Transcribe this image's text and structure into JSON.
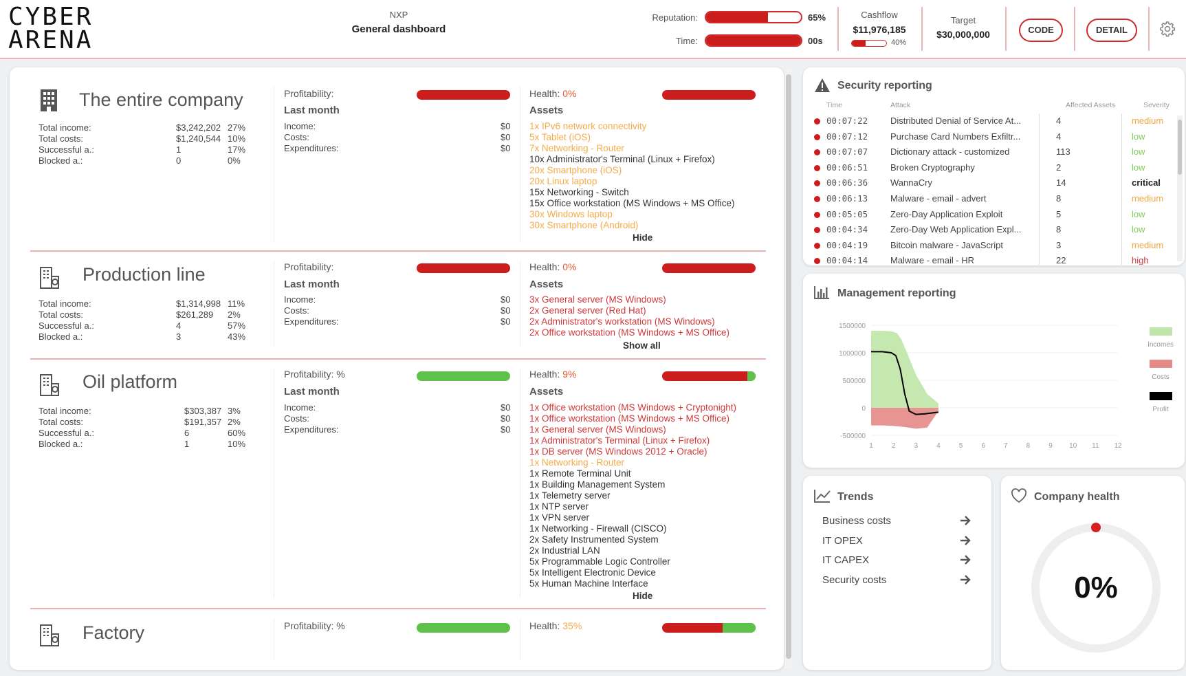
{
  "header": {
    "logo_line1": "CYBER",
    "logo_line2": "ARENA",
    "org": "NXP",
    "title": "General dashboard",
    "reputation_label": "Reputation:",
    "reputation_value": "65%",
    "reputation_level": 0.65,
    "time_label": "Time:",
    "time_value": "00s",
    "time_level": 1.0,
    "cashflow_label": "Cashflow",
    "cashflow_value": "$11,976,185",
    "cashflow_percent": "40%",
    "cashflow_level": 0.4,
    "target_label": "Target",
    "target_value": "$30,000,000",
    "code_button": "CODE",
    "detail_button": "DETAIL"
  },
  "sections": [
    {
      "title": "The entire company",
      "stats": [
        {
          "label": "Total income:",
          "value": "$3,242,202",
          "pct": "27%"
        },
        {
          "label": "Total costs:",
          "value": "$1,240,544",
          "pct": "10%"
        },
        {
          "label": "Successful a.:",
          "value": "1",
          "pct": "17%"
        },
        {
          "label": "Blocked a.:",
          "value": "0",
          "pct": "0%"
        }
      ],
      "profitability_label": "Profitability:",
      "last_month": "Last month",
      "lm": [
        {
          "label": "Income:",
          "value": "$0"
        },
        {
          "label": "Costs:",
          "value": "$0"
        },
        {
          "label": "Expenditures:",
          "value": "$0"
        }
      ],
      "health_label": "Health:",
      "health_value": "0%",
      "assets_label": "Assets",
      "assets": [
        {
          "text": "1x IPv6 network connectivity",
          "color": "orange"
        },
        {
          "text": "5x Tablet (iOS)",
          "color": "orange"
        },
        {
          "text": "7x Networking - Router",
          "color": "orange"
        },
        {
          "text": "10x Administrator's Terminal (Linux + Firefox)",
          "color": "dark"
        },
        {
          "text": "20x Smartphone (iOS)",
          "color": "orange"
        },
        {
          "text": "20x Linux laptop",
          "color": "orange"
        },
        {
          "text": "15x Networking - Switch",
          "color": "dark"
        },
        {
          "text": "15x Office workstation (MS Windows + MS Office)",
          "color": "dark"
        },
        {
          "text": "30x Windows laptop",
          "color": "orange"
        },
        {
          "text": "30x Smartphone (Android)",
          "color": "orange"
        }
      ],
      "toggle": "Hide"
    },
    {
      "title": "Production line",
      "stats": [
        {
          "label": "Total income:",
          "value": "$1,314,998",
          "pct": "11%"
        },
        {
          "label": "Total costs:",
          "value": "$261,289",
          "pct": "2%"
        },
        {
          "label": "Successful a.:",
          "value": "4",
          "pct": "57%"
        },
        {
          "label": "Blocked a.:",
          "value": "3",
          "pct": "43%"
        }
      ],
      "profitability_label": "Profitability:",
      "last_month": "Last month",
      "lm": [
        {
          "label": "Income:",
          "value": "$0"
        },
        {
          "label": "Costs:",
          "value": "$0"
        },
        {
          "label": "Expenditures:",
          "value": "$0"
        }
      ],
      "health_label": "Health:",
      "health_value": "0%",
      "assets_label": "Assets",
      "assets": [
        {
          "text": "3x General server (MS Windows)",
          "color": "red"
        },
        {
          "text": "2x General server (Red Hat)",
          "color": "red"
        },
        {
          "text": "2x Administrator's workstation (MS Windows)",
          "color": "red"
        },
        {
          "text": "2x Office workstation (MS Windows + MS Office)",
          "color": "red"
        }
      ],
      "toggle": "Show all"
    },
    {
      "title": "Oil platform",
      "stats": [
        {
          "label": "Total income:",
          "value": "$303,387",
          "pct": "3%"
        },
        {
          "label": "Total costs:",
          "value": "$191,357",
          "pct": "2%"
        },
        {
          "label": "Successful a.:",
          "value": "6",
          "pct": "60%"
        },
        {
          "label": "Blocked a.:",
          "value": "1",
          "pct": "10%"
        }
      ],
      "profitability_label": "Profitability: %",
      "last_month": "Last month",
      "lm": [
        {
          "label": "Income:",
          "value": "$0"
        },
        {
          "label": "Costs:",
          "value": "$0"
        },
        {
          "label": "Expenditures:",
          "value": "$0"
        }
      ],
      "health_label": "Health:",
      "health_value": "9%",
      "assets_label": "Assets",
      "assets": [
        {
          "text": "1x Office workstation (MS Windows + Cryptonight)",
          "color": "red"
        },
        {
          "text": "1x Office workstation (MS Windows + MS Office)",
          "color": "red"
        },
        {
          "text": "1x General server (MS Windows)",
          "color": "red"
        },
        {
          "text": "1x Administrator's Terminal (Linux + Firefox)",
          "color": "red"
        },
        {
          "text": "1x DB server (MS Windows 2012 + Oracle)",
          "color": "red"
        },
        {
          "text": "1x Networking - Router",
          "color": "orange"
        },
        {
          "text": "1x Remote Terminal Unit",
          "color": "dark"
        },
        {
          "text": "1x Building Management System",
          "color": "dark"
        },
        {
          "text": "1x Telemetry server",
          "color": "dark"
        },
        {
          "text": "1x NTP server",
          "color": "dark"
        },
        {
          "text": "1x VPN server",
          "color": "dark"
        },
        {
          "text": "1x Networking - Firewall (CISCO)",
          "color": "dark"
        },
        {
          "text": "2x Safety Instrumented System",
          "color": "dark"
        },
        {
          "text": "2x Industrial LAN",
          "color": "dark"
        },
        {
          "text": "5x Programmable Logic Controller",
          "color": "dark"
        },
        {
          "text": "5x Intelligent Electronic Device",
          "color": "dark"
        },
        {
          "text": "5x Human Machine Interface",
          "color": "dark"
        }
      ],
      "toggle": "Hide"
    },
    {
      "title": "Factory",
      "profitability_label": "Profitability: %",
      "health_label": "Health:",
      "health_value": "35%"
    }
  ],
  "security": {
    "title": "Security reporting",
    "columns": [
      "Time",
      "Attack",
      "Affected Assets",
      "Severity"
    ],
    "rows": [
      {
        "time": "00:07:22",
        "attack": "Distributed Denial of Service At...",
        "assets": "4",
        "severity": "medium"
      },
      {
        "time": "00:07:12",
        "attack": "Purchase Card Numbers Exfiltr...",
        "assets": "4",
        "severity": "low"
      },
      {
        "time": "00:07:07",
        "attack": "Dictionary attack - customized",
        "assets": "113",
        "severity": "low"
      },
      {
        "time": "00:06:51",
        "attack": "Broken Cryptography",
        "assets": "2",
        "severity": "low"
      },
      {
        "time": "00:06:36",
        "attack": "WannaCry",
        "assets": "14",
        "severity": "critical"
      },
      {
        "time": "00:06:13",
        "attack": "Malware - email - advert",
        "assets": "8",
        "severity": "medium"
      },
      {
        "time": "00:05:05",
        "attack": "Zero-Day Application Exploit",
        "assets": "5",
        "severity": "low"
      },
      {
        "time": "00:04:34",
        "attack": "Zero-Day Web Application Expl...",
        "assets": "8",
        "severity": "low"
      },
      {
        "time": "00:04:19",
        "attack": "Bitcoin malware - JavaScript",
        "assets": "3",
        "severity": "medium"
      },
      {
        "time": "00:04:14",
        "attack": "Malware - email - HR",
        "assets": "22",
        "severity": "high"
      }
    ]
  },
  "management": {
    "title": "Management reporting"
  },
  "chart_data": {
    "type": "area",
    "x": [
      1,
      2,
      3,
      4,
      5,
      6,
      7,
      8,
      9,
      10,
      11,
      12
    ],
    "y_ticks": [
      "1500000",
      "1000000",
      "500000",
      "0",
      "-500000"
    ],
    "ylim": [
      -500000,
      1500000
    ],
    "series": [
      {
        "name": "Incomes",
        "color": "#bfe6a8",
        "x": [
          1,
          1.5,
          1.9,
          2.15,
          2.35,
          2.6,
          3.0,
          3.5,
          4.0
        ],
        "values": [
          1400000,
          1400000,
          1390000,
          1360000,
          1240000,
          1000000,
          600000,
          250000,
          80000
        ]
      },
      {
        "name": "Costs",
        "color": "#e48a87",
        "x": [
          1,
          1.5,
          2.0,
          2.5,
          3.0,
          3.5,
          4.0
        ],
        "values": [
          -320000,
          -320000,
          -330000,
          -350000,
          -380000,
          -360000,
          -60000
        ]
      },
      {
        "name": "Profit",
        "color": "#000000",
        "x": [
          1,
          1.5,
          1.9,
          2.1,
          2.3,
          2.5,
          2.7,
          3.0,
          3.4,
          4.0
        ],
        "values": [
          1020000,
          1020000,
          1000000,
          950000,
          700000,
          250000,
          -60000,
          -120000,
          -110000,
          -80000
        ]
      }
    ],
    "legend": [
      "Incomes",
      "Costs",
      "Profit"
    ],
    "legend_position": "right"
  },
  "trends": {
    "title": "Trends",
    "items": [
      "Business costs",
      "IT OPEX",
      "IT CAPEX",
      "Security costs"
    ]
  },
  "health_card": {
    "title": "Company health",
    "value": "0%",
    "level": 0.0
  }
}
